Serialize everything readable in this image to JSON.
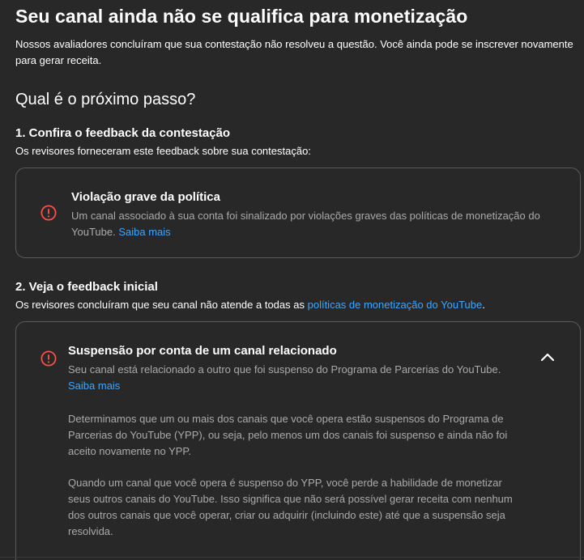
{
  "header": {
    "title": "Seu canal ainda não se qualifica para monetização",
    "intro": "Nossos avaliadores concluíram que sua contestação não resolveu a questão. Você ainda pode se inscrever novamente para gerar receita."
  },
  "next": {
    "heading": "Qual é o próximo passo?"
  },
  "step1": {
    "title": "1. Confira o feedback da contestação",
    "description": "Os revisores forneceram este feedback sobre sua contestação:",
    "card": {
      "icon": "alert-circle-icon",
      "title": "Violação grave da política",
      "body": "Um canal associado à sua conta foi sinalizado por violações graves das políticas de monetização do YouTube.",
      "link": "Saiba mais"
    }
  },
  "step2": {
    "title": "2. Veja o feedback inicial",
    "description_prefix": "Os revisores concluíram que seu canal não atende a todas as ",
    "description_link": "políticas de monetização do YouTube",
    "description_suffix": ".",
    "card": {
      "icon": "alert-circle-icon",
      "title": "Suspensão por conta de um canal relacionado",
      "summary": "Seu canal está relacionado a outro que foi suspenso do Programa de Parcerias do YouTube.",
      "link": "Saiba mais",
      "collapse_icon": "chevron-up-icon",
      "paragraph1": "Determinamos que um ou mais dos canais que você opera estão suspensos do Programa de Parcerias do YouTube (YPP), ou seja, pelo menos um dos canais foi suspenso e ainda não foi aceito novamente no YPP.",
      "paragraph2": "Quando um canal que você opera é suspenso do YPP, você perde a habilidade de monetizar seus outros canais do YouTube. Isso significa que não será possível gerar receita com nenhum dos outros canais que você operar, criar ou adquirir (incluindo este) até que a suspensão seja resolvida."
    }
  },
  "colors": {
    "background": "#282828",
    "text": "#ffffff",
    "secondary_text": "#aaaaaa",
    "link": "#3ea6ff",
    "alert": "#ff4e45",
    "card_border": "#5a5a5a"
  }
}
